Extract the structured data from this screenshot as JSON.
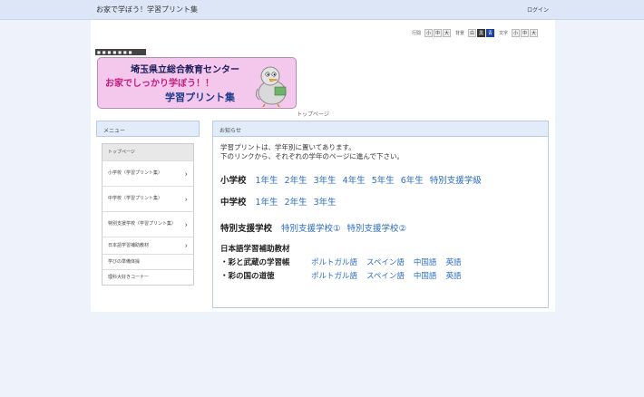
{
  "header": {
    "site_title": "お家で学ぼう！学習プリント集",
    "login": "ログイン"
  },
  "controls": {
    "layout_label": "行間",
    "layout": [
      "小",
      "中",
      "大"
    ],
    "bg_label": "背景",
    "bg": [
      "白",
      "黒",
      "青"
    ],
    "text_label": "文字",
    "text": [
      "小",
      "中",
      "大"
    ]
  },
  "logo": {
    "strip": "■■■■■■■",
    "line1": "埼玉県立総合教育センター",
    "line2": "お家でしっかり学ぼう！！",
    "line3": "学習プリント集",
    "colors": {
      "bg": "#f3c8ec",
      "pink": "#c41d7f",
      "navy": "#1c3a8a"
    }
  },
  "breadcrumb": "トップページ",
  "menu": {
    "title": "メニュー",
    "items": [
      {
        "label": "トップページ",
        "arrow": false,
        "top": true
      },
      {
        "label": "小学校（学習プリント集）",
        "arrow": true
      },
      {
        "label": "中学校（学習プリント集）",
        "arrow": true
      },
      {
        "label": "特別支援学校（学習プリント集）",
        "arrow": true
      },
      {
        "label": "日本語学習補助教材",
        "arrow": true
      },
      {
        "label": "学びの準備体操",
        "arrow": false
      },
      {
        "label": "理科大好きコーナー",
        "arrow": false
      }
    ]
  },
  "news": {
    "title": "お知らせ",
    "intro1": "学習プリントは、学年別に置いてあります。",
    "intro2": "下のリンクから、それぞれの学年のページに進んで下さい。",
    "elementary": {
      "label": "小学校",
      "links": [
        "1年生",
        "2年生",
        "3年生",
        "4年生",
        "5年生",
        "6年生",
        "特別支援学級"
      ]
    },
    "junior": {
      "label": "中学校",
      "links": [
        "1年生",
        "2年生",
        "3年生"
      ]
    },
    "special": {
      "label": "特別支援学校",
      "links": [
        "特別支援学校①",
        "特別支援学校②"
      ]
    },
    "japanese": {
      "label": "日本語学習補助教材",
      "rows": [
        {
          "label": "・彩と武蔵の学習帳",
          "links": [
            "ポルトガル語",
            "スペイン語",
            "中国語",
            "英語"
          ]
        },
        {
          "label": "・彩の国の道徳",
          "links": [
            "ポルトガル語",
            "スペイン語",
            "中国語",
            "英語"
          ]
        }
      ]
    }
  }
}
